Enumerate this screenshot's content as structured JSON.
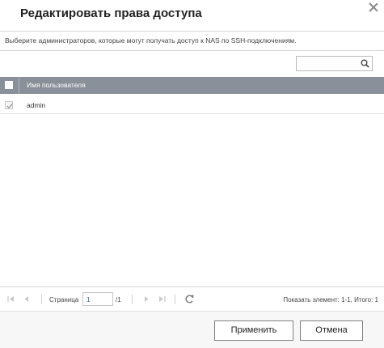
{
  "dialog": {
    "title": "Редактировать права доступа",
    "description": "Выберите администраторов, которые могут получать доступ к NAS по SSH-подключениям."
  },
  "search": {
    "value": "",
    "placeholder": ""
  },
  "table": {
    "columns": [
      "Имя пользователя"
    ],
    "rows": [
      {
        "username": "admin",
        "checked": true
      }
    ]
  },
  "pager": {
    "page_label": "Страница",
    "page_value": "1",
    "total_pages": "/1",
    "info": "Показать элемент: 1-1, Итого: 1"
  },
  "buttons": {
    "apply": "Применить",
    "cancel": "Отмена"
  },
  "colors": {
    "header_bg": "#8a9099",
    "page_input_text": "#2a6fb5"
  }
}
